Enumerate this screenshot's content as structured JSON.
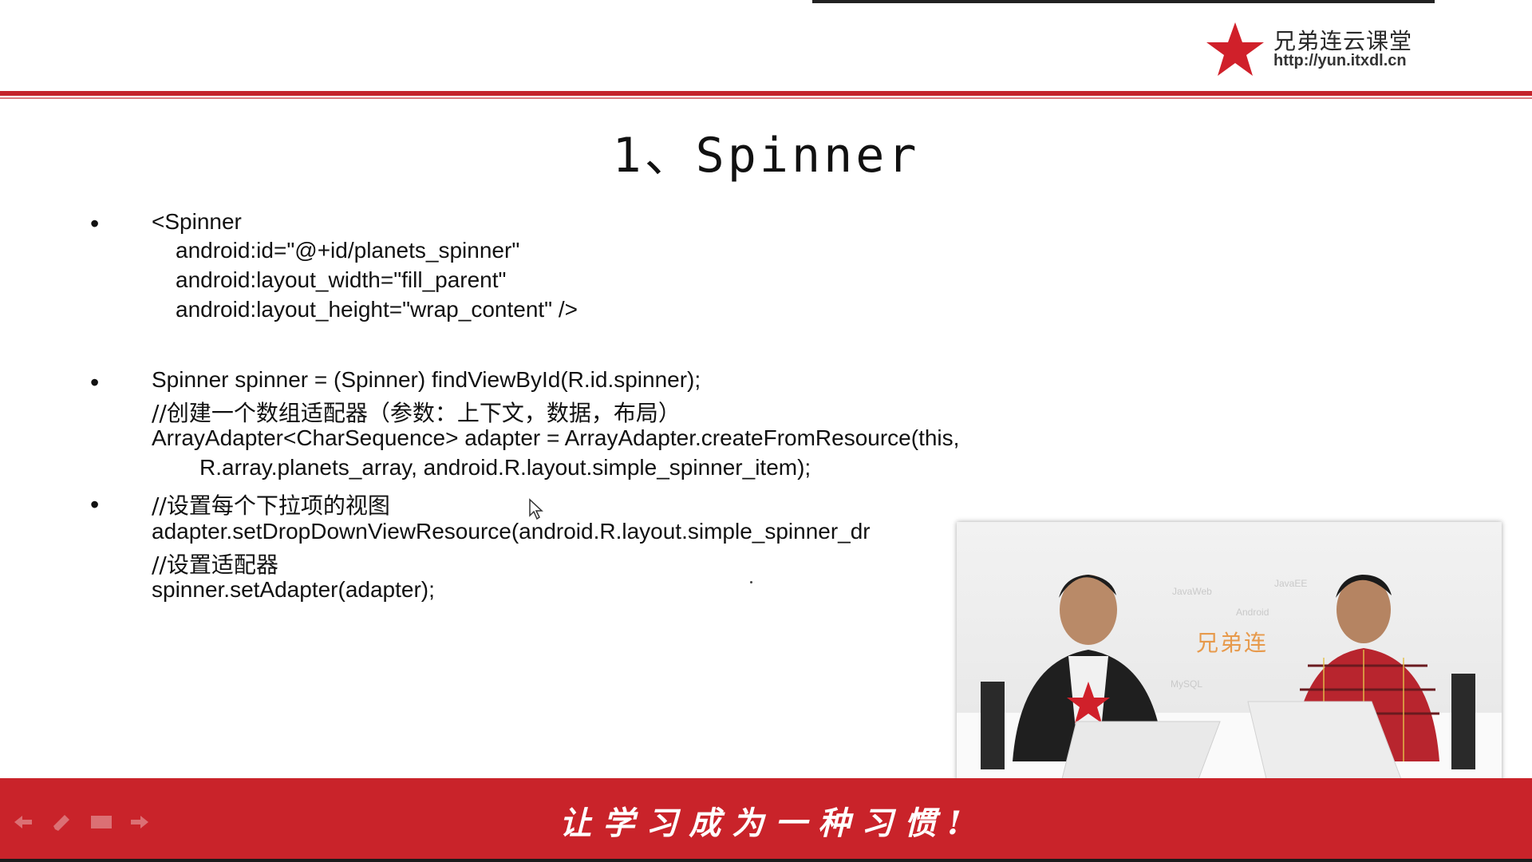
{
  "logo": {
    "name": "兄弟连云课堂",
    "url": "http://yun.itxdl.cn"
  },
  "slide": {
    "title": "1、Spinner"
  },
  "content": {
    "bullet_char": "•",
    "lines": [
      "<Spinner",
      "android:id=\"@+id/planets_spinner\"",
      "android:layout_width=\"fill_parent\"",
      "android:layout_height=\"wrap_content\" />",
      "Spinner spinner = (Spinner) findViewById(R.id.spinner);",
      "//创建一个数组适配器（参数：上下文，数据，布局）",
      "ArrayAdapter<CharSequence> adapter = ArrayAdapter.createFromResource(this,",
      "R.array.planets_array, android.R.layout.simple_spinner_item);",
      "//设置每个下拉项的视图",
      "adapter.setDropDownViewResource(android.R.layout.simple_spinner_dr",
      "//设置适配器",
      "spinner.setAdapter(adapter);"
    ]
  },
  "video": {
    "brand": "兄弟连",
    "tags": [
      "JavaWeb",
      "JavaEE",
      "Android",
      "MySQL"
    ]
  },
  "footer": {
    "slogan": "让学习成为一种习惯!"
  },
  "controls": {
    "icons": [
      "arrow-left-icon",
      "pen-icon",
      "menu-icon",
      "arrow-right-icon"
    ]
  },
  "colors": {
    "brand_red": "#c9232a",
    "text": "#111111"
  }
}
